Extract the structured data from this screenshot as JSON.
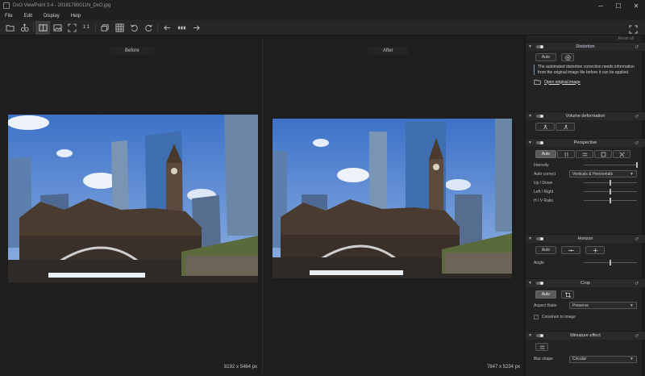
{
  "window": {
    "title": "DxO ViewPoint 3.4 - 20161780011N_DxO.jpg",
    "minimize": "─",
    "maximize": "☐",
    "close": "✕"
  },
  "menu": [
    "File",
    "Edit",
    "Display",
    "Help"
  ],
  "toolbar": {
    "actual_size_label": "1:1"
  },
  "viewer": {
    "before_label": "Before",
    "after_label": "After",
    "before_dims": "8192 x 5464 px",
    "after_dims": "7847 x 5234 px"
  },
  "panel": {
    "reset_all": "Reset all",
    "distortion": {
      "title": "Distortion",
      "auto": "Auto",
      "info": "The automated distortion correction needs information from the original image file before it can be applied.",
      "open_link": "Open original image"
    },
    "volume": {
      "title": "Volume deformation"
    },
    "perspective": {
      "title": "Perspective",
      "auto": "Auto",
      "intensity_label": "Intensity",
      "intensity_value": 1.0,
      "auto_correct_label": "Auto correct",
      "auto_correct_value": "Verticals & Horizontals",
      "up_down_label": "Up / Down",
      "up_down_value": 0.5,
      "left_right_label": "Left / Right",
      "left_right_value": 0.5,
      "hv_ratio_label": "H / V Ratio",
      "hv_ratio_value": 0.5
    },
    "horizon": {
      "title": "Horizon",
      "auto": "Auto",
      "angle_label": "Angle",
      "angle_value": 0.5
    },
    "crop": {
      "title": "Crop",
      "auto": "Auto",
      "aspect_label": "Aspect Ratio",
      "aspect_value": "Preserve",
      "constrain_label": "Constrain to image"
    },
    "miniature": {
      "title": "Miniature effect",
      "blur_label": "Blur shape",
      "blur_value": "Circular"
    }
  }
}
